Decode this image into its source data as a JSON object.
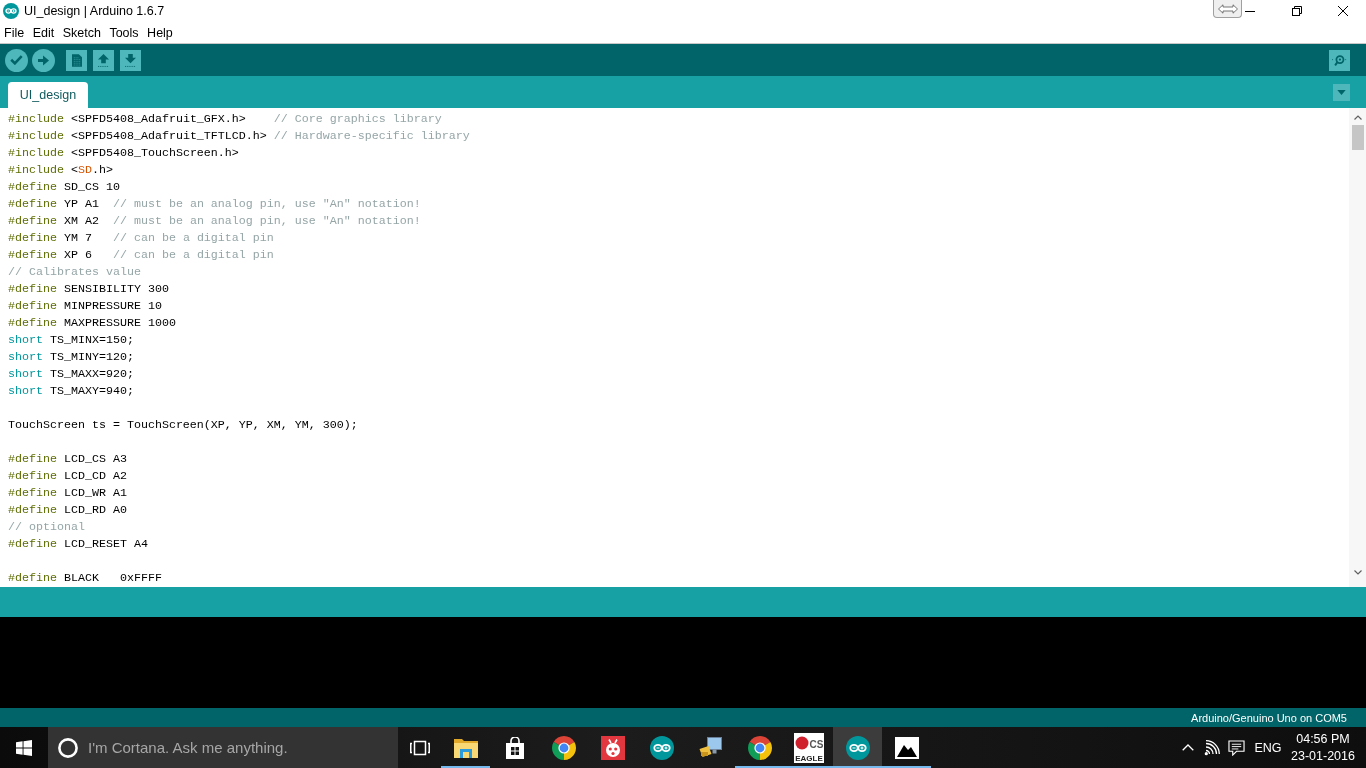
{
  "window": {
    "title": "UI_design | Arduino 1.6.7"
  },
  "menu": [
    "File",
    "Edit",
    "Sketch",
    "Tools",
    "Help"
  ],
  "tabs": [
    {
      "label": "UI_design",
      "selected": true
    }
  ],
  "editor": {
    "lines": [
      {
        "kind": "code",
        "tokens": [
          {
            "kind": "directive",
            "text": "#include"
          },
          {
            "kind": "plain",
            "text": " <SPFD5408_Adafruit_GFX.h>    "
          },
          {
            "kind": "comment",
            "text": "// Core graphics library"
          }
        ]
      },
      {
        "kind": "code",
        "tokens": [
          {
            "kind": "directive",
            "text": "#include"
          },
          {
            "kind": "plain",
            "text": " <SPFD5408_Adafruit_TFTLCD.h> "
          },
          {
            "kind": "comment",
            "text": "// Hardware-specific library"
          }
        ]
      },
      {
        "kind": "code",
        "tokens": [
          {
            "kind": "directive",
            "text": "#include"
          },
          {
            "kind": "plain",
            "text": " <SPFD5408_TouchScreen.h>"
          }
        ]
      },
      {
        "kind": "code",
        "tokens": [
          {
            "kind": "directive",
            "text": "#include"
          },
          {
            "kind": "plain",
            "text": " <"
          },
          {
            "kind": "library",
            "text": "SD"
          },
          {
            "kind": "plain",
            "text": ".h>"
          }
        ]
      },
      {
        "kind": "code",
        "tokens": [
          {
            "kind": "directive",
            "text": "#define"
          },
          {
            "kind": "plain",
            "text": " SD_CS 10"
          }
        ]
      },
      {
        "kind": "code",
        "tokens": [
          {
            "kind": "directive",
            "text": "#define"
          },
          {
            "kind": "plain",
            "text": " YP A1  "
          },
          {
            "kind": "comment",
            "text": "// must be an analog pin, use \"An\" notation!"
          }
        ]
      },
      {
        "kind": "code",
        "tokens": [
          {
            "kind": "directive",
            "text": "#define"
          },
          {
            "kind": "plain",
            "text": " XM A2  "
          },
          {
            "kind": "comment",
            "text": "// must be an analog pin, use \"An\" notation!"
          }
        ]
      },
      {
        "kind": "code",
        "tokens": [
          {
            "kind": "directive",
            "text": "#define"
          },
          {
            "kind": "plain",
            "text": " YM 7   "
          },
          {
            "kind": "comment",
            "text": "// can be a digital pin"
          }
        ]
      },
      {
        "kind": "code",
        "tokens": [
          {
            "kind": "directive",
            "text": "#define"
          },
          {
            "kind": "plain",
            "text": " XP 6   "
          },
          {
            "kind": "comment",
            "text": "// can be a digital pin"
          }
        ]
      },
      {
        "kind": "code",
        "tokens": [
          {
            "kind": "comment",
            "text": "// Calibrates value"
          }
        ]
      },
      {
        "kind": "code",
        "tokens": [
          {
            "kind": "directive",
            "text": "#define"
          },
          {
            "kind": "plain",
            "text": " SENSIBILITY 300"
          }
        ]
      },
      {
        "kind": "code",
        "tokens": [
          {
            "kind": "directive",
            "text": "#define"
          },
          {
            "kind": "plain",
            "text": " MINPRESSURE 10"
          }
        ]
      },
      {
        "kind": "code",
        "tokens": [
          {
            "kind": "directive",
            "text": "#define"
          },
          {
            "kind": "plain",
            "text": " MAXPRESSURE 1000"
          }
        ]
      },
      {
        "kind": "code",
        "tokens": [
          {
            "kind": "keyword",
            "text": "short"
          },
          {
            "kind": "plain",
            "text": " TS_MINX=150;"
          }
        ]
      },
      {
        "kind": "code",
        "tokens": [
          {
            "kind": "keyword",
            "text": "short"
          },
          {
            "kind": "plain",
            "text": " TS_MINY=120;"
          }
        ]
      },
      {
        "kind": "code",
        "tokens": [
          {
            "kind": "keyword",
            "text": "short"
          },
          {
            "kind": "plain",
            "text": " TS_MAXX=920;"
          }
        ]
      },
      {
        "kind": "code",
        "tokens": [
          {
            "kind": "keyword",
            "text": "short"
          },
          {
            "kind": "plain",
            "text": " TS_MAXY=940;"
          }
        ]
      },
      {
        "kind": "blank"
      },
      {
        "kind": "code",
        "tokens": [
          {
            "kind": "plain",
            "text": "TouchScreen ts = TouchScreen(XP, YP, XM, YM, 300);"
          }
        ]
      },
      {
        "kind": "blank"
      },
      {
        "kind": "code",
        "tokens": [
          {
            "kind": "directive",
            "text": "#define"
          },
          {
            "kind": "plain",
            "text": " LCD_CS A3"
          }
        ]
      },
      {
        "kind": "code",
        "tokens": [
          {
            "kind": "directive",
            "text": "#define"
          },
          {
            "kind": "plain",
            "text": " LCD_CD A2"
          }
        ]
      },
      {
        "kind": "code",
        "tokens": [
          {
            "kind": "directive",
            "text": "#define"
          },
          {
            "kind": "plain",
            "text": " LCD_WR A1"
          }
        ]
      },
      {
        "kind": "code",
        "tokens": [
          {
            "kind": "directive",
            "text": "#define"
          },
          {
            "kind": "plain",
            "text": " LCD_RD A0"
          }
        ]
      },
      {
        "kind": "code",
        "tokens": [
          {
            "kind": "comment",
            "text": "// optional"
          }
        ]
      },
      {
        "kind": "code",
        "tokens": [
          {
            "kind": "directive",
            "text": "#define"
          },
          {
            "kind": "plain",
            "text": " LCD_RESET A4"
          }
        ]
      },
      {
        "kind": "blank"
      },
      {
        "kind": "code",
        "tokens": [
          {
            "kind": "directive",
            "text": "#define"
          },
          {
            "kind": "plain",
            "text": " BLACK   0xFFFF"
          }
        ]
      }
    ]
  },
  "status_bar": {
    "board": "Arduino/Genuino Uno on COM5"
  },
  "taskbar": {
    "search": {
      "placeholder": "I'm Cortana. Ask me anything."
    },
    "apps": [
      {
        "kind": "folder",
        "running": true,
        "selected": false
      },
      {
        "kind": "bag",
        "running": false,
        "selected": false
      },
      {
        "kind": "wheel",
        "running": false,
        "selected": false
      },
      {
        "kind": "ladybug",
        "running": false,
        "selected": false
      },
      {
        "kind": "infinity",
        "running": false,
        "selected": false
      },
      {
        "kind": "computer",
        "running": false,
        "selected": false
      },
      {
        "kind": "wheel",
        "running": true,
        "selected": false
      },
      {
        "kind": "emblem",
        "running": true,
        "selected": false,
        "logo": {
          "mark": "CS",
          "caption": "EAGLE"
        }
      },
      {
        "kind": "infinity",
        "running": true,
        "selected": true
      },
      {
        "kind": "mountains",
        "running": true,
        "selected": false
      }
    ],
    "tray": {
      "language": "ENG",
      "time": "04:56 PM",
      "date": "23-01-2016"
    }
  }
}
